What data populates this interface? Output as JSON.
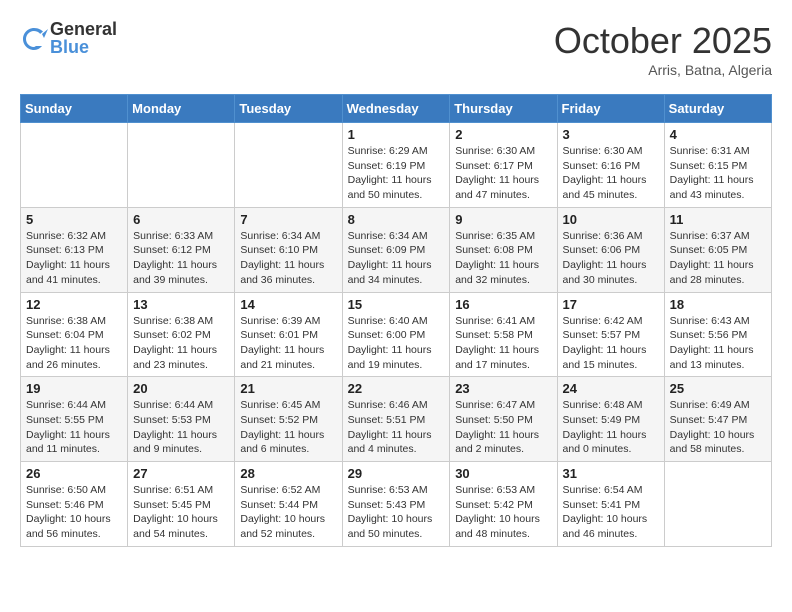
{
  "logo": {
    "general": "General",
    "blue": "Blue"
  },
  "header": {
    "month": "October 2025",
    "location": "Arris, Batna, Algeria"
  },
  "weekdays": [
    "Sunday",
    "Monday",
    "Tuesday",
    "Wednesday",
    "Thursday",
    "Friday",
    "Saturday"
  ],
  "weeks": [
    [
      {
        "day": "",
        "info": ""
      },
      {
        "day": "",
        "info": ""
      },
      {
        "day": "",
        "info": ""
      },
      {
        "day": "1",
        "info": "Sunrise: 6:29 AM\nSunset: 6:19 PM\nDaylight: 11 hours\nand 50 minutes."
      },
      {
        "day": "2",
        "info": "Sunrise: 6:30 AM\nSunset: 6:17 PM\nDaylight: 11 hours\nand 47 minutes."
      },
      {
        "day": "3",
        "info": "Sunrise: 6:30 AM\nSunset: 6:16 PM\nDaylight: 11 hours\nand 45 minutes."
      },
      {
        "day": "4",
        "info": "Sunrise: 6:31 AM\nSunset: 6:15 PM\nDaylight: 11 hours\nand 43 minutes."
      }
    ],
    [
      {
        "day": "5",
        "info": "Sunrise: 6:32 AM\nSunset: 6:13 PM\nDaylight: 11 hours\nand 41 minutes."
      },
      {
        "day": "6",
        "info": "Sunrise: 6:33 AM\nSunset: 6:12 PM\nDaylight: 11 hours\nand 39 minutes."
      },
      {
        "day": "7",
        "info": "Sunrise: 6:34 AM\nSunset: 6:10 PM\nDaylight: 11 hours\nand 36 minutes."
      },
      {
        "day": "8",
        "info": "Sunrise: 6:34 AM\nSunset: 6:09 PM\nDaylight: 11 hours\nand 34 minutes."
      },
      {
        "day": "9",
        "info": "Sunrise: 6:35 AM\nSunset: 6:08 PM\nDaylight: 11 hours\nand 32 minutes."
      },
      {
        "day": "10",
        "info": "Sunrise: 6:36 AM\nSunset: 6:06 PM\nDaylight: 11 hours\nand 30 minutes."
      },
      {
        "day": "11",
        "info": "Sunrise: 6:37 AM\nSunset: 6:05 PM\nDaylight: 11 hours\nand 28 minutes."
      }
    ],
    [
      {
        "day": "12",
        "info": "Sunrise: 6:38 AM\nSunset: 6:04 PM\nDaylight: 11 hours\nand 26 minutes."
      },
      {
        "day": "13",
        "info": "Sunrise: 6:38 AM\nSunset: 6:02 PM\nDaylight: 11 hours\nand 23 minutes."
      },
      {
        "day": "14",
        "info": "Sunrise: 6:39 AM\nSunset: 6:01 PM\nDaylight: 11 hours\nand 21 minutes."
      },
      {
        "day": "15",
        "info": "Sunrise: 6:40 AM\nSunset: 6:00 PM\nDaylight: 11 hours\nand 19 minutes."
      },
      {
        "day": "16",
        "info": "Sunrise: 6:41 AM\nSunset: 5:58 PM\nDaylight: 11 hours\nand 17 minutes."
      },
      {
        "day": "17",
        "info": "Sunrise: 6:42 AM\nSunset: 5:57 PM\nDaylight: 11 hours\nand 15 minutes."
      },
      {
        "day": "18",
        "info": "Sunrise: 6:43 AM\nSunset: 5:56 PM\nDaylight: 11 hours\nand 13 minutes."
      }
    ],
    [
      {
        "day": "19",
        "info": "Sunrise: 6:44 AM\nSunset: 5:55 PM\nDaylight: 11 hours\nand 11 minutes."
      },
      {
        "day": "20",
        "info": "Sunrise: 6:44 AM\nSunset: 5:53 PM\nDaylight: 11 hours\nand 9 minutes."
      },
      {
        "day": "21",
        "info": "Sunrise: 6:45 AM\nSunset: 5:52 PM\nDaylight: 11 hours\nand 6 minutes."
      },
      {
        "day": "22",
        "info": "Sunrise: 6:46 AM\nSunset: 5:51 PM\nDaylight: 11 hours\nand 4 minutes."
      },
      {
        "day": "23",
        "info": "Sunrise: 6:47 AM\nSunset: 5:50 PM\nDaylight: 11 hours\nand 2 minutes."
      },
      {
        "day": "24",
        "info": "Sunrise: 6:48 AM\nSunset: 5:49 PM\nDaylight: 11 hours\nand 0 minutes."
      },
      {
        "day": "25",
        "info": "Sunrise: 6:49 AM\nSunset: 5:47 PM\nDaylight: 10 hours\nand 58 minutes."
      }
    ],
    [
      {
        "day": "26",
        "info": "Sunrise: 6:50 AM\nSunset: 5:46 PM\nDaylight: 10 hours\nand 56 minutes."
      },
      {
        "day": "27",
        "info": "Sunrise: 6:51 AM\nSunset: 5:45 PM\nDaylight: 10 hours\nand 54 minutes."
      },
      {
        "day": "28",
        "info": "Sunrise: 6:52 AM\nSunset: 5:44 PM\nDaylight: 10 hours\nand 52 minutes."
      },
      {
        "day": "29",
        "info": "Sunrise: 6:53 AM\nSunset: 5:43 PM\nDaylight: 10 hours\nand 50 minutes."
      },
      {
        "day": "30",
        "info": "Sunrise: 6:53 AM\nSunset: 5:42 PM\nDaylight: 10 hours\nand 48 minutes."
      },
      {
        "day": "31",
        "info": "Sunrise: 6:54 AM\nSunset: 5:41 PM\nDaylight: 10 hours\nand 46 minutes."
      },
      {
        "day": "",
        "info": ""
      }
    ]
  ]
}
